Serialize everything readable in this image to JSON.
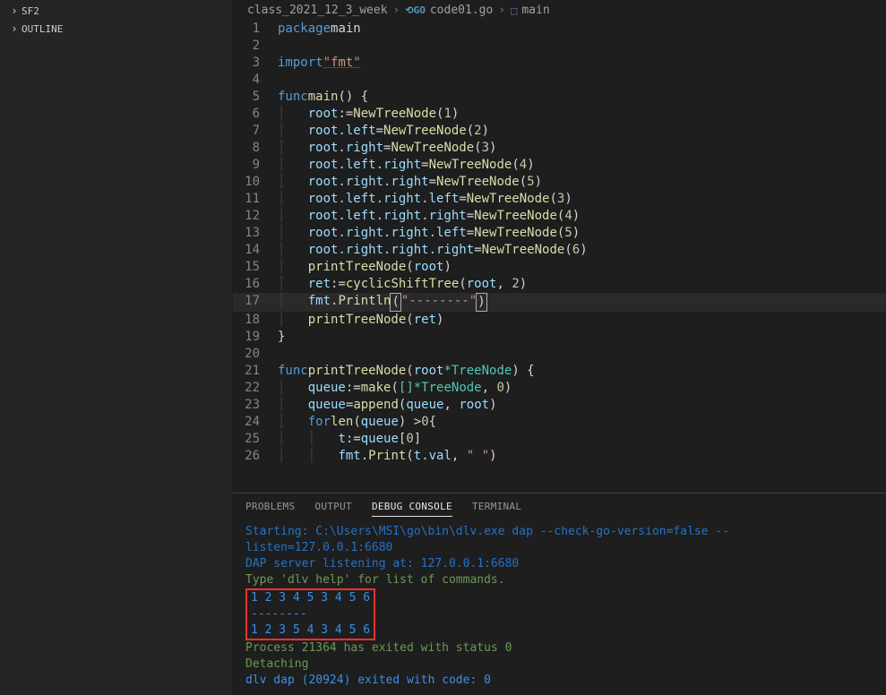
{
  "sidebar": {
    "items": [
      "SF2",
      "OUTLINE"
    ]
  },
  "breadcrumbs": {
    "folder": "class_2021_12_3_week",
    "file": "code01.go",
    "symbol": "main"
  },
  "code": {
    "l1": {
      "kw": "package",
      "id": "main"
    },
    "l3": {
      "kw": "import",
      "str": "\"fmt\""
    },
    "l5": {
      "kw": "func",
      "fn": "main",
      "p": "() {"
    },
    "l6": {
      "id": "root",
      "op": ":=",
      "fn": "NewTreeNode",
      "arg": "1"
    },
    "l7": {
      "lhs": "root.left",
      "op": "=",
      "fn": "NewTreeNode",
      "arg": "2"
    },
    "l8": {
      "lhs": "root.right",
      "op": "=",
      "fn": "NewTreeNode",
      "arg": "3"
    },
    "l9": {
      "lhs": "root.left.right",
      "op": "=",
      "fn": "NewTreeNode",
      "arg": "4"
    },
    "l10": {
      "lhs": "root.right.right",
      "op": "=",
      "fn": "NewTreeNode",
      "arg": "5"
    },
    "l11": {
      "lhs": "root.left.right.left",
      "op": "=",
      "fn": "NewTreeNode",
      "arg": "3"
    },
    "l12": {
      "lhs": "root.left.right.right",
      "op": "=",
      "fn": "NewTreeNode",
      "arg": "4"
    },
    "l13": {
      "lhs": "root.right.right.left",
      "op": "=",
      "fn": "NewTreeNode",
      "arg": "5"
    },
    "l14": {
      "lhs": "root.right.right.right",
      "op": "=",
      "fn": "NewTreeNode",
      "arg": "6"
    },
    "l15": {
      "fn": "printTreeNode",
      "arg": "root"
    },
    "l16": {
      "id": "ret",
      "op": ":=",
      "fn": "cyclicShiftTree",
      "arg1": "root",
      "arg2": "2"
    },
    "l17": {
      "pkg": "fmt",
      "fn": "Println",
      "str": "\"--------\""
    },
    "l18": {
      "fn": "printTreeNode",
      "arg": "ret"
    },
    "l19": {
      "p": "}"
    },
    "l21": {
      "kw": "func",
      "fn": "printTreeNode",
      "arg": "root",
      "typ": "*TreeNode",
      "p": ") {"
    },
    "l22": {
      "id": "queue",
      "op": ":=",
      "fn": "make",
      "t": "[]*TreeNode",
      "n": "0"
    },
    "l23": {
      "id": "queue",
      "op": "=",
      "fn": "append",
      "a": "queue",
      "b": "root"
    },
    "l24": {
      "kw": "for",
      "fn": "len",
      "a": "queue",
      "cmp": ">",
      "n": "0",
      "p": "{"
    },
    "l25": {
      "id": "t",
      "op": ":=",
      "rhs": "queue",
      "idx": "0"
    },
    "l26": {
      "pkg": "fmt",
      "fn": "Print",
      "a": "t.val",
      "str": "\" \""
    }
  },
  "panel": {
    "tabs": [
      "PROBLEMS",
      "OUTPUT",
      "DEBUG CONSOLE",
      "TERMINAL"
    ]
  },
  "console": {
    "l1": "Starting: C:\\Users\\MSI\\go\\bin\\dlv.exe dap --check-go-version=false --listen=127.0.0.1:6680",
    "l2": "DAP server listening at: 127.0.0.1:6680",
    "l3": "Type 'dlv help' for list of commands.",
    "r1": "1 2 3 4 5 3 4 5 6 ",
    "r2": "--------",
    "r3": "1 2 3 5 4 3 4 5 6 ",
    "l4": "Process 21364 has exited with status 0",
    "l5": "Detaching",
    "l6": "dlv dap (20924) exited with code: 0"
  }
}
